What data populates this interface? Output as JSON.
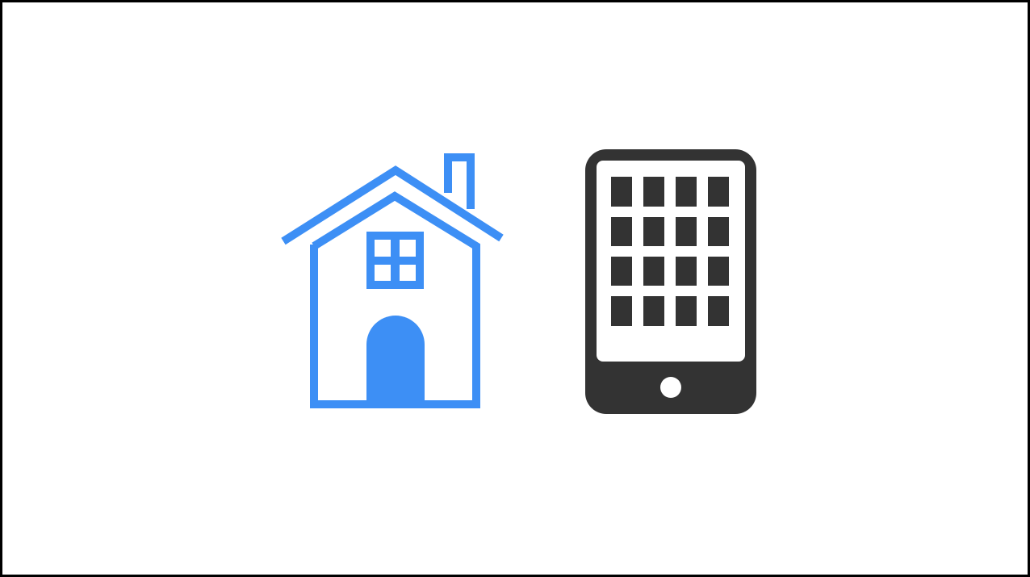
{
  "icons": [
    {
      "name": "house-icon",
      "color": "#3d8ff5"
    },
    {
      "name": "tablet-icon",
      "color": "#333333",
      "screen_color": "#ffffff",
      "button_color": "#ffffff"
    }
  ],
  "frame": {
    "border_color": "#000000",
    "background": "#ffffff"
  }
}
